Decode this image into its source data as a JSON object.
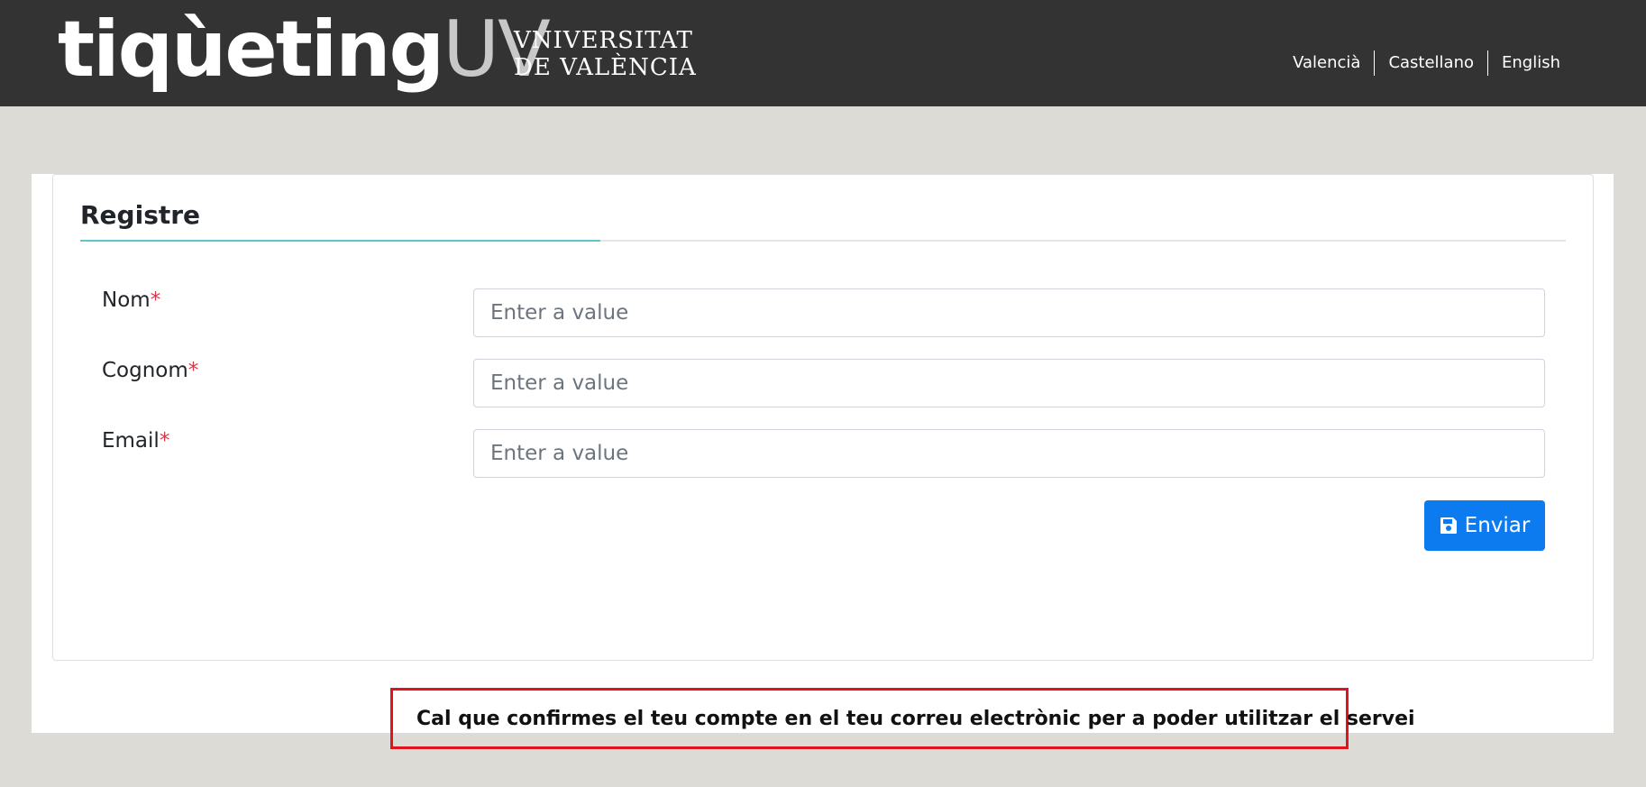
{
  "header": {
    "logo_main": "tiqùeting",
    "logo_suffix": "UV",
    "university_line1": "VNIVERSITAT",
    "university_line2": "DE VALÈNCIA",
    "languages": [
      "Valencià",
      "Castellano",
      "English"
    ]
  },
  "form": {
    "title": "Registre",
    "required_mark": "*",
    "fields": [
      {
        "label": "Nom",
        "placeholder": "Enter a value",
        "value": ""
      },
      {
        "label": "Cognom",
        "placeholder": "Enter a value",
        "value": ""
      },
      {
        "label": "Email",
        "placeholder": "Enter a value",
        "value": ""
      }
    ],
    "submit_label": "Enviar",
    "submit_icon": "save-icon"
  },
  "notice": {
    "text": "Cal que confirmes el teu compte en el teu correu electrònic per a poder utilitzar el servei"
  },
  "colors": {
    "header_bg": "#333333",
    "page_bg": "#dcdbd6",
    "accent_rule": "#5fc6c9",
    "button_bg": "#0d7bf0",
    "required": "#dc3545",
    "notice_border": "#e0141e"
  }
}
